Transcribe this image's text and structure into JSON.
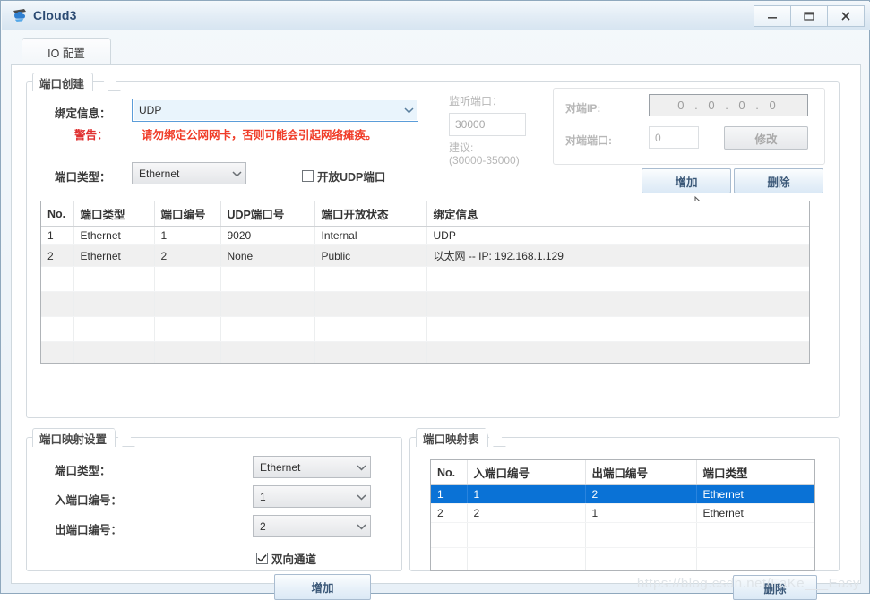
{
  "window": {
    "title": "Cloud3",
    "icon": "cloud-app-icon",
    "minimize_label": "–",
    "maximize_label": "❐",
    "close_label": "✕"
  },
  "tabs": [
    {
      "label": "IO 配置",
      "name": "tab-io-config",
      "active": true
    }
  ],
  "port_create": {
    "group_title": "端口创建",
    "binding_label": "绑定信息：",
    "binding_value": "UDP",
    "warning_key": "警告：",
    "warning_text": "请勿绑定公网网卡，否则可能会引起网络瘫痪。",
    "port_type_label": "端口类型：",
    "port_type_value": "Ethernet",
    "open_udp_label": "开放UDP端口",
    "open_udp_checked": false,
    "listen_port_label": "监听端口：",
    "listen_port_value": "30000",
    "suggest_label": "建议:",
    "suggest_range": "(30000-35000)",
    "peer_ip_label": "对端IP:",
    "peer_ip_value": "0 . 0 . 0 . 0",
    "peer_port_label": "对端端口:",
    "peer_port_value": "0",
    "modify_button": "修改",
    "add_button": "增加",
    "delete_button": "删除"
  },
  "port_table": {
    "columns": [
      "No.",
      "端口类型",
      "端口编号",
      "UDP端口号",
      "端口开放状态",
      "绑定信息"
    ],
    "rows": [
      {
        "no": "1",
        "type": "Ethernet",
        "number": "1",
        "udp_port": "9020",
        "state": "Internal",
        "binding": "UDP"
      },
      {
        "no": "2",
        "type": "Ethernet",
        "number": "2",
        "udp_port": "None",
        "state": "Public",
        "binding": "以太网 -- IP: 192.168.1.129"
      }
    ],
    "empty_row_count": 5
  },
  "mapping_settings": {
    "group_title": "端口映射设置",
    "port_type_label": "端口类型：",
    "port_type_value": "Ethernet",
    "in_port_label": "入端口编号：",
    "in_port_value": "1",
    "out_port_label": "出端口编号：",
    "out_port_value": "2",
    "bidirectional_label": "双向通道",
    "bidirectional_checked": true,
    "add_button": "增加"
  },
  "mapping_table": {
    "group_title": "端口映射表",
    "columns": [
      "No.",
      "入端口编号",
      "出端口编号",
      "端口类型"
    ],
    "rows": [
      {
        "no": "1",
        "in_port": "1",
        "out_port": "2",
        "type": "Ethernet",
        "selected": true
      },
      {
        "no": "2",
        "in_port": "2",
        "out_port": "1",
        "type": "Ethernet",
        "selected": false
      }
    ],
    "empty_row_count": 3,
    "delete_button": "删除"
  },
  "watermark": "https://blog.csdn.net/FaKe___Easy",
  "colors": {
    "title_text": "#2b4a72",
    "warning": "#f03c28",
    "selection": "#0a72d6",
    "alt_row": "#f0f0f0"
  }
}
